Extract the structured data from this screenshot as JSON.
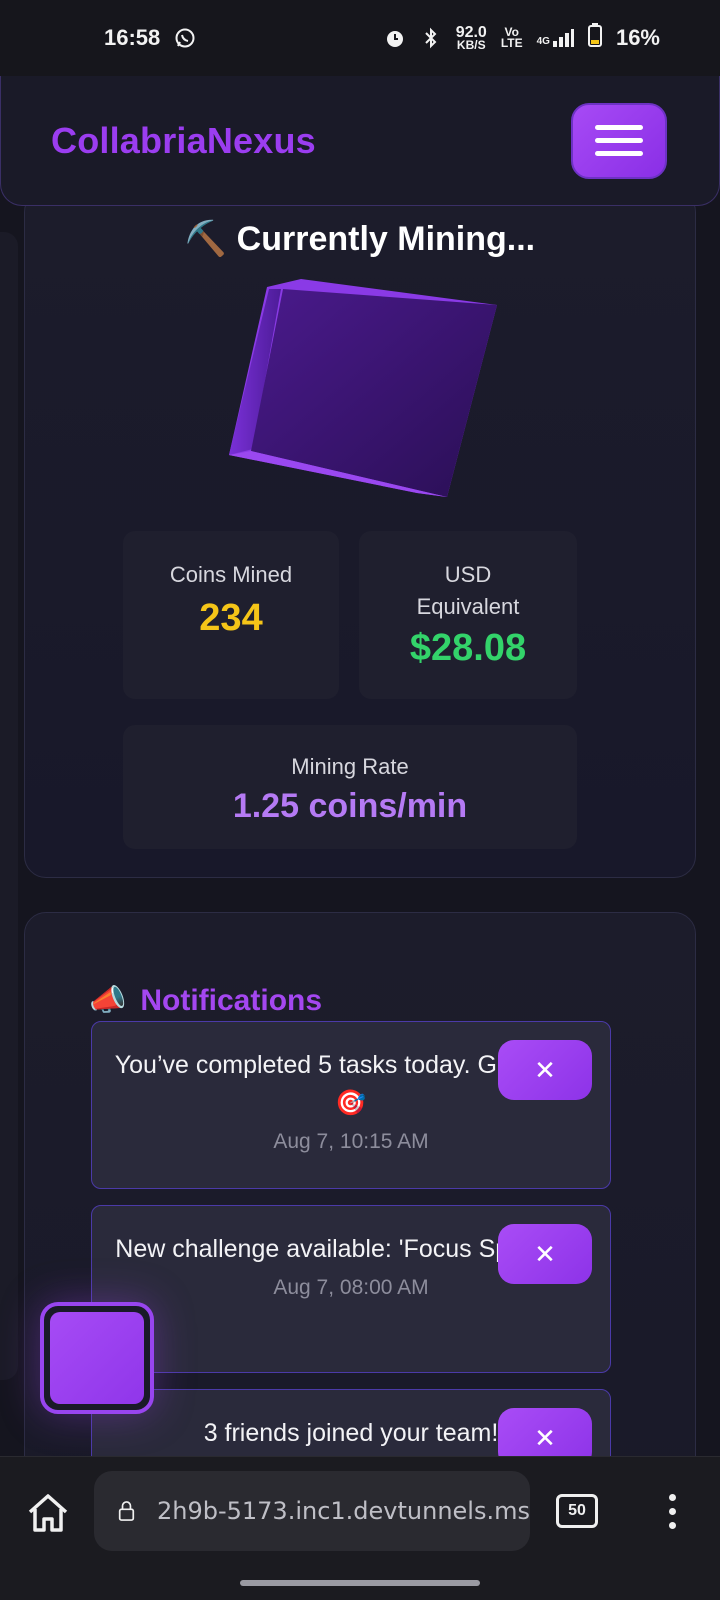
{
  "status_bar": {
    "time": "16:58",
    "net_speed": "92.0",
    "net_unit": "KB/S",
    "volte_top": "Vo",
    "volte_bottom": "LTE",
    "signal": "4G",
    "battery": "16%",
    "icons": [
      "whatsapp-icon",
      "alarm-icon",
      "bluetooth-icon",
      "signal-icon",
      "battery-icon"
    ]
  },
  "header": {
    "brand": "CollabriaNexus",
    "menu_icon": "hamburger-icon"
  },
  "mining": {
    "title": "⛏️ Currently Mining...",
    "coins_label": "Coins Mined",
    "coins_value": "234",
    "usd_label": "USD Equivalent",
    "usd_value": "$28.08",
    "rate_label": "Mining Rate",
    "rate_value": "1.25 coins/min"
  },
  "notifications": {
    "heading_icon": "📣",
    "title": "Notifications",
    "items": [
      {
        "text": "You’ve completed 5 tasks today. Great job! 🎯",
        "time": "Aug 7, 10:15 AM",
        "close": "✕"
      },
      {
        "text": "New challenge available: 'Focus Sprint' 🔔",
        "time": "Aug 7, 08:00 AM",
        "close": "✕"
      },
      {
        "text": "3 friends joined your team!",
        "time": "",
        "close": "✕"
      }
    ]
  },
  "browser": {
    "url": "2h9b-5173.inc1.devtunnels.ms",
    "tab_count": "50",
    "icons": [
      "home-icon",
      "lock-icon",
      "more-vert-icon"
    ]
  },
  "colors": {
    "accent": "#9b3df0",
    "coins": "#f5c518",
    "usd": "#33d36a",
    "rate": "#b57af4"
  }
}
